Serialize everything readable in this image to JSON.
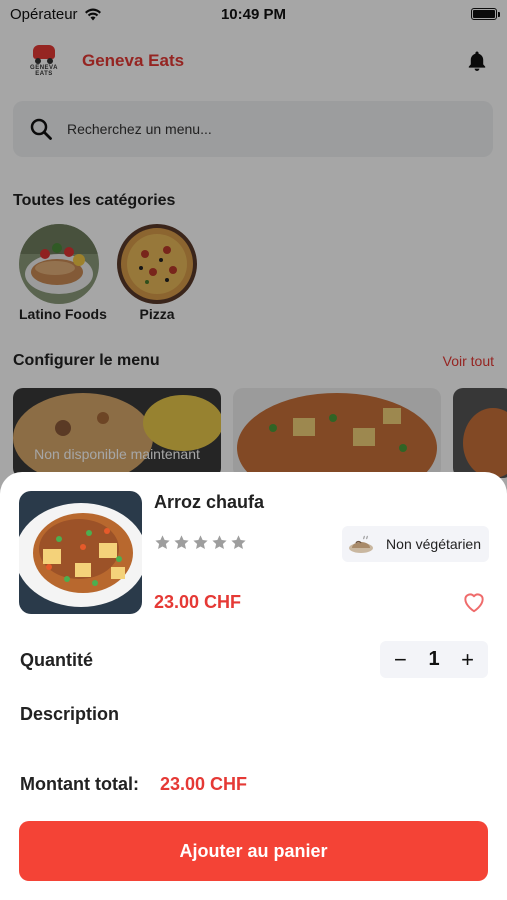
{
  "status_bar": {
    "carrier": "Opérateur",
    "time": "10:49 PM"
  },
  "header": {
    "brand": "Geneva Eats",
    "logo_text": "GENEVA EATS"
  },
  "search": {
    "placeholder": "Recherchez un menu..."
  },
  "categories": {
    "title": "Toutes les catégories",
    "items": [
      {
        "label": "Latino Foods"
      },
      {
        "label": "Pizza"
      }
    ]
  },
  "menu_section": {
    "title": "Configurer le menu",
    "see_all": "Voir tout",
    "unavailable": "Non disponible maintenant"
  },
  "sheet": {
    "dish_name": "Arroz chaufa",
    "rating": 0,
    "rating_max": 5,
    "veg_badge": "Non végétarien",
    "price": "23.00 CHF",
    "quantity_label": "Quantité",
    "quantity_value": "1",
    "minus": "−",
    "plus": "+",
    "description_label": "Description",
    "total_label": "Montant total:",
    "total_value": "23.00 CHF",
    "add_to_cart": "Ajouter au panier"
  },
  "colors": {
    "accent": "#e53935",
    "button": "#f44336"
  }
}
